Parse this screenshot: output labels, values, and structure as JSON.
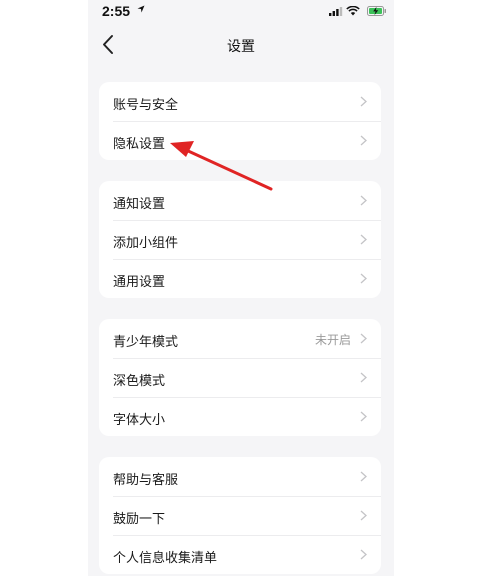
{
  "status_bar": {
    "time": "2:55"
  },
  "nav": {
    "title": "设置"
  },
  "groups": [
    {
      "items": [
        {
          "label": "账号与安全"
        },
        {
          "label": "隐私设置"
        }
      ]
    },
    {
      "items": [
        {
          "label": "通知设置"
        },
        {
          "label": "添加小组件"
        },
        {
          "label": "通用设置"
        }
      ]
    },
    {
      "items": [
        {
          "label": "青少年模式",
          "value": "未开启"
        },
        {
          "label": "深色模式"
        },
        {
          "label": "字体大小"
        }
      ]
    },
    {
      "items": [
        {
          "label": "帮助与客服"
        },
        {
          "label": "鼓励一下"
        },
        {
          "label": "个人信息收集清单"
        }
      ]
    }
  ],
  "colors": {
    "background": "#f5f5f7",
    "card": "#ffffff",
    "annotation_arrow": "#e02424"
  },
  "icons": [
    "location-arrow-icon",
    "signal-icon",
    "wifi-icon",
    "battery-charging-icon",
    "back-chevron-icon",
    "chevron-right-icon"
  ]
}
